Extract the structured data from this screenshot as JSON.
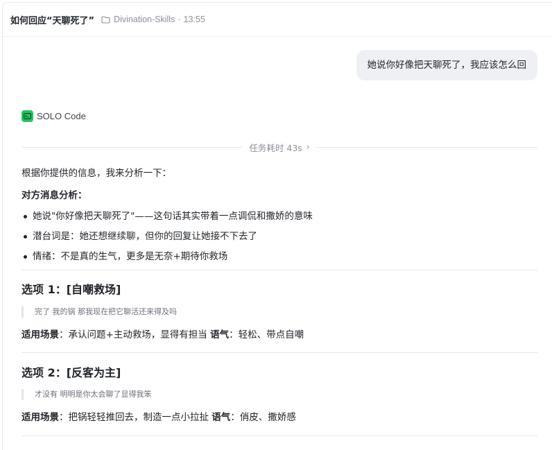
{
  "header": {
    "title": "如何回应“天聊死了”",
    "project": "Divination-Skills",
    "separator": "·",
    "time": "13:55"
  },
  "user_message": "她说你好像把天聊死了，我应该怎么回",
  "agent": {
    "name": "SOLO Code",
    "icon": "terminal-icon",
    "icon_color": "#23c55e"
  },
  "task": {
    "label": "任务耗时 43s"
  },
  "response": {
    "intro": "根据你提供的信息，我来分析一下：",
    "analysis_heading": "对方消息分析：",
    "bullets": [
      "她说\"你好像把天聊死了\"——这句话其实带着一点调侃和撒娇的意味",
      "潜台词是：她还想继续聊，但你的回复让她接不下去了",
      "情绪：不是真的生气，更多是无奈+期待你救场"
    ],
    "options": [
      {
        "title": "选项 1：[自嘲救场]",
        "quote": "完了 我的锅 那我现在把它聊活还来得及吗",
        "scene_label": "适用场景",
        "scene_text": "：承认问题+主动救场，显得有担当 ",
        "tone_label": "语气",
        "tone_text": "：轻松、带点自嘲"
      },
      {
        "title": "选项 2：[反客为主]",
        "quote": "才没有 明明是你太会聊了显得我笨",
        "scene_label": "适用场景",
        "scene_text": "：把锅轻轻推回去，制造一点小拉扯 ",
        "tone_label": "语气",
        "tone_text": "：俏皮、撒娇感"
      }
    ]
  }
}
